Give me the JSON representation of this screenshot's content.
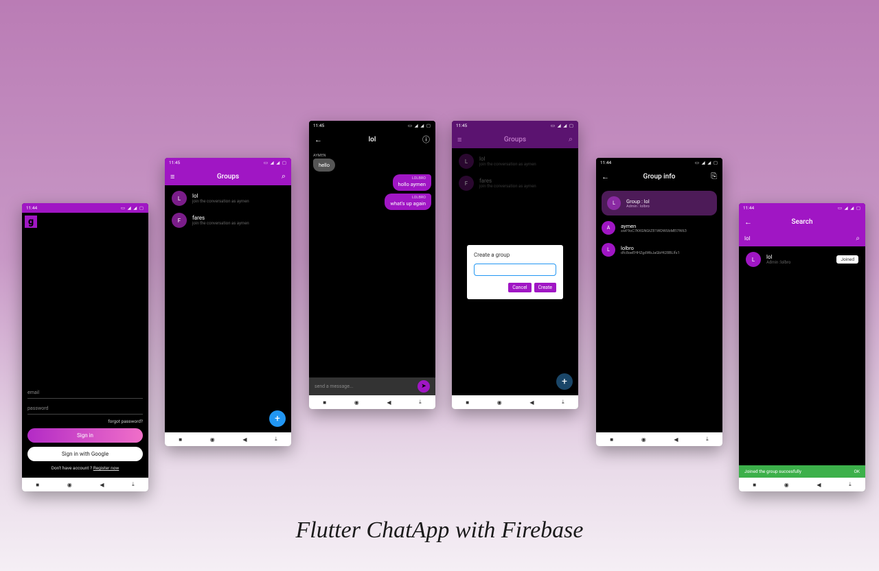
{
  "caption": "Flutter ChatApp with Firebase",
  "status_time": "11:45",
  "status_time_alt": "11:44",
  "status_icons": "▭ ◢ ◢ ▢",
  "login": {
    "logo_letter": "g",
    "email_ph": "email",
    "password_ph": "password",
    "forgot": "forgot password?",
    "signin": "Sign in",
    "google": "Sign in with Google",
    "noacct": "Don't have account ? ",
    "register": "Register now"
  },
  "groups": {
    "title": "Groups",
    "items": [
      {
        "letter": "L",
        "name": "lol",
        "sub": "join the conversation as aymen"
      },
      {
        "letter": "F",
        "name": "fares",
        "sub": "join the conversation as aymen"
      }
    ]
  },
  "chat": {
    "title": "lol",
    "messages": [
      {
        "dir": "in",
        "name": "AYMEN",
        "text": "hello"
      },
      {
        "dir": "out",
        "name": "LOLBRO",
        "text": "hollo aymen"
      },
      {
        "dir": "out",
        "name": "LOLBRO",
        "text": "what's up again"
      }
    ],
    "composer_ph": "send a message..."
  },
  "dialog": {
    "screen_title": "Groups",
    "list": [
      {
        "letter": "L",
        "name": "lol",
        "sub": "join the conversation as aymen"
      },
      {
        "letter": "F",
        "name": "fares",
        "sub": "join the conversation as aymen"
      }
    ],
    "title": "Create a group",
    "cancel": "Cancel",
    "create": "Create"
  },
  "info": {
    "title": "Group info",
    "header_avatar": "L",
    "header_line1": "Group : lol",
    "header_line2": "Admin : lolbro",
    "members": [
      {
        "letter": "A",
        "name": "aymen",
        "sub": "swF9oC7KKGNGtZ81WDWUbMEl7W63"
      },
      {
        "letter": "L",
        "name": "lolbro",
        "sub": "dfc8oeEHHZgdWbJaGbHt28BLlfs1"
      }
    ]
  },
  "search": {
    "title": "Search",
    "query": "lol",
    "result": {
      "letter": "L",
      "name": "lol",
      "sub": "Admin :lolbro"
    },
    "chip": "Joined",
    "snack": "Joined the group succesfully",
    "snack_action": "OK"
  },
  "nav": {
    "square": "■",
    "circle": "◉",
    "back": "◀",
    "down": "⤓"
  }
}
